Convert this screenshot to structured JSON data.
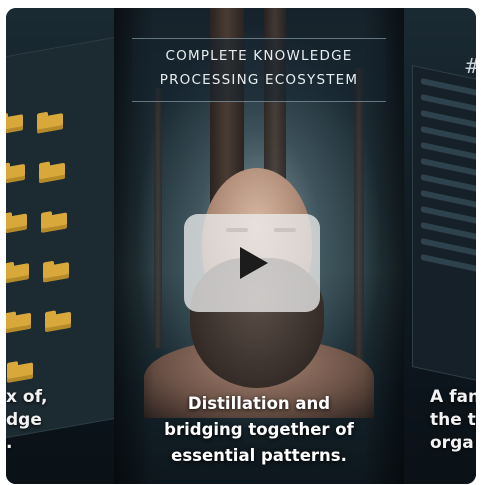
{
  "slides": {
    "left": {
      "caption_lines": [
        "x of,",
        "dge",
        "."
      ]
    },
    "center": {
      "title_lines": [
        "COMPLETE KNOWLEDGE",
        "PROCESSING ECOSYSTEM"
      ],
      "caption_lines": [
        "Distillation and",
        "bridging together of",
        "essential patterns."
      ]
    },
    "right": {
      "hash_text": "#.",
      "caption_lines": [
        "A fant",
        "the t",
        "orga"
      ]
    }
  },
  "player": {
    "play_icon": "play-icon"
  }
}
